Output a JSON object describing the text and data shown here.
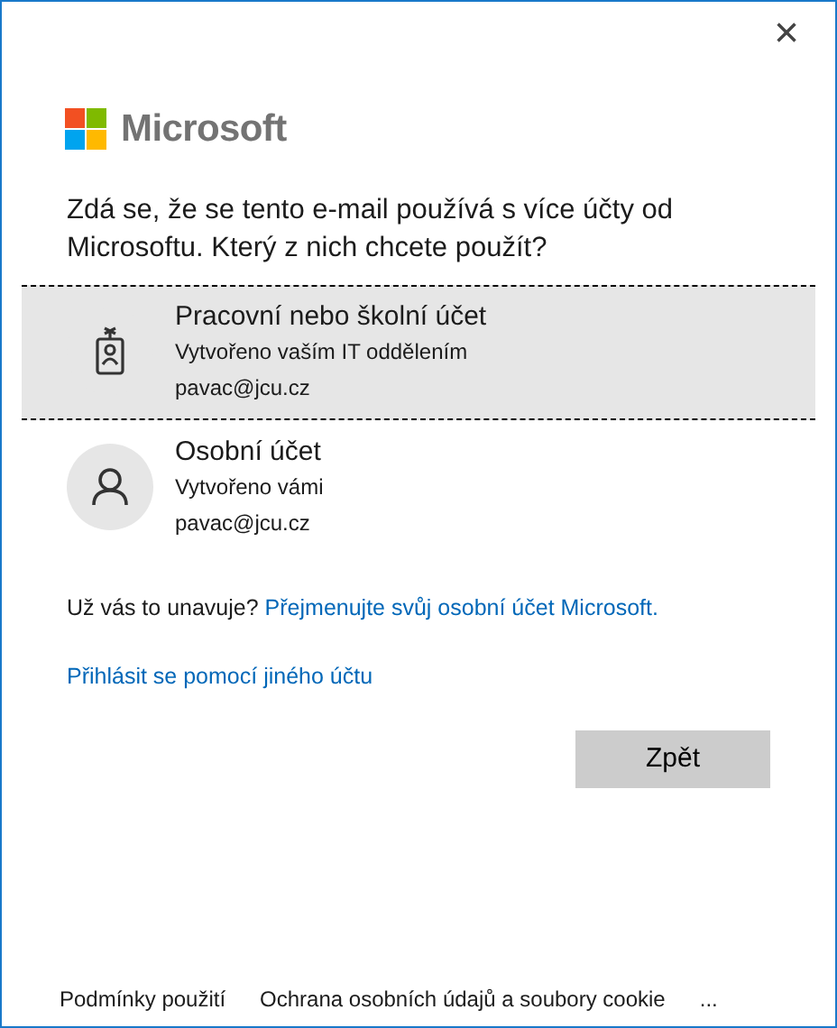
{
  "close": "×",
  "logo": {
    "text": "Microsoft"
  },
  "heading": "Zdá se, že se tento e-mail používá s více účty od Microsoftu. Který z nich chcete použít?",
  "accounts": [
    {
      "kind": "work",
      "title": "Pracovní nebo školní účet",
      "subtitle": "Vytvořeno vaším IT oddělením",
      "email": "pavac@jcu.cz",
      "selected": true
    },
    {
      "kind": "personal",
      "title": "Osobní účet",
      "subtitle": "Vytvořeno vámi",
      "email": "pavac@jcu.cz",
      "selected": false
    }
  ],
  "rename": {
    "text": "Už vás to unavuje?",
    "link": "Přejmenujte svůj osobní účet Microsoft."
  },
  "other_account_link": "Přihlásit se pomocí jiného účtu",
  "back_button": "Zpět",
  "footer": [
    "Podmínky použití",
    "Ochrana osobních údajů a soubory cookie",
    "..."
  ]
}
